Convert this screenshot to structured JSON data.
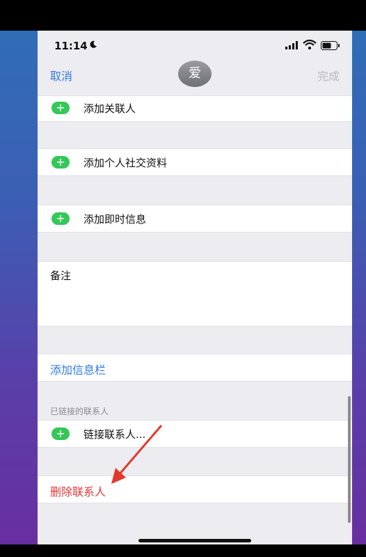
{
  "status_bar": {
    "time": "11:14"
  },
  "nav": {
    "cancel": "取消",
    "avatar_text": "爱",
    "done": "完成"
  },
  "rows": {
    "add_related": "添加关联人",
    "add_social": "添加个人社交资料",
    "add_im": "添加即时信息",
    "notes": "备注",
    "add_field": "添加信息栏",
    "linked_header": "已链接的联系人",
    "link_contact": "链接联系人...",
    "delete_contact": "删除联系人"
  },
  "colors": {
    "accent_blue": "#2f7ae6",
    "plus_green": "#35c759",
    "delete_red": "#e23a3a",
    "arrow_red": "#e23a2a"
  },
  "icons": [
    "moon-icon",
    "cellular-signal-icon",
    "wifi-icon",
    "battery-icon",
    "add-circle-icon",
    "arrow-annotation-icon"
  ]
}
